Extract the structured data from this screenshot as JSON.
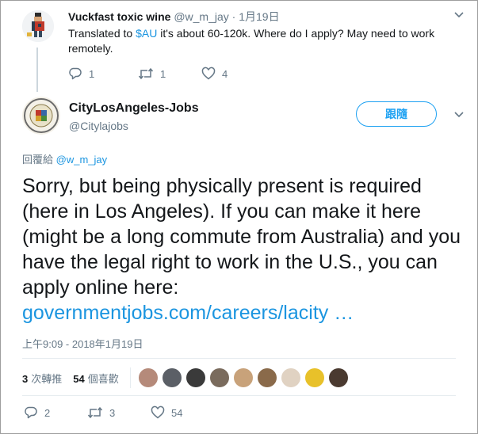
{
  "parent_tweet": {
    "name": "Vuckfast toxic wine",
    "handle": "@w_m_jay",
    "separator": "·",
    "date": "1月19日",
    "text_before": "Translated to ",
    "cashtag": "$AU",
    "text_after": " it's about 60-120k. Where do I apply? May need to work remotely.",
    "replies": "1",
    "retweets": "1",
    "likes": "4"
  },
  "main_tweet": {
    "name": "CityLosAngeles-Jobs",
    "handle": "@Citylajobs",
    "follow_label": "跟隨",
    "reply_prefix": "回覆給",
    "reply_mention": "@w_m_jay",
    "text": "Sorry, but being physically present is required (here in Los Angeles).  If you can make it here (might be a long commute from Australia) and you have the legal right to work in the U.S., you can apply online here: ",
    "link": "governmentjobs.com/careers/lacity …",
    "timestamp": "上午9:09 - 2018年1月19日",
    "retweet_count": "3",
    "retweet_label": "次轉推",
    "like_count": "54",
    "like_label": "個喜歡",
    "likers": [
      {
        "name": "liker-1",
        "color": "#b58a7a"
      },
      {
        "name": "liker-2",
        "color": "#5b5f66"
      },
      {
        "name": "liker-3",
        "color": "#3a3a3a"
      },
      {
        "name": "liker-4",
        "color": "#7a6b5d"
      },
      {
        "name": "liker-5",
        "color": "#c8a27a"
      },
      {
        "name": "liker-6",
        "color": "#8a6a4a"
      },
      {
        "name": "liker-7",
        "color": "#e0d2c2"
      },
      {
        "name": "liker-8",
        "color": "#e8c12a"
      },
      {
        "name": "liker-9",
        "color": "#4a3a30"
      }
    ],
    "replies": "2",
    "retweets": "3",
    "likes": "54"
  },
  "icons": {
    "reply": "reply-icon",
    "retweet": "retweet-icon",
    "like": "heart-icon",
    "menu": "chevron-down-icon"
  },
  "colors": {
    "accent": "#1da1f2",
    "link": "#1b95e0",
    "muted": "#657786",
    "text": "#14171a"
  }
}
